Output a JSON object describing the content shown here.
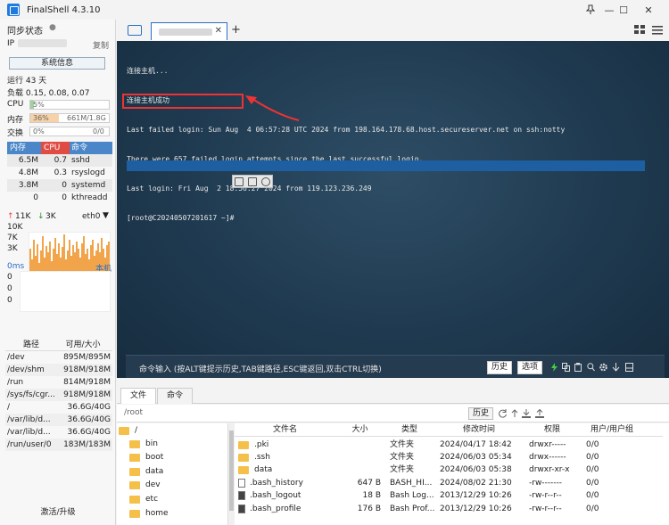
{
  "titlebar": {
    "app_title": "FinalShell 4.3.10",
    "minimize": "—",
    "maximize": "☐",
    "close": "✕"
  },
  "left": {
    "sync_label": "同步状态",
    "ip_label": "IP",
    "copy_label": "复制",
    "sysinfo_button": "系统信息",
    "uptime": "运行 43 天",
    "load": "负载 0.15, 0.08, 0.07",
    "cpu": {
      "label": "CPU",
      "value": "5%",
      "fraction": 0.05
    },
    "mem": {
      "label": "内存",
      "percent": "36%",
      "detail": "661M/1.8G",
      "fraction": 0.36
    },
    "swap": {
      "label": "交换",
      "percent": "0%",
      "detail": "0/0",
      "fraction": 0.0
    },
    "proc_headers": [
      "内存",
      "CPU",
      "命令"
    ],
    "processes": [
      {
        "mem": "6.5M",
        "cpu": "0.7",
        "cmd": "sshd"
      },
      {
        "mem": "4.8M",
        "cpu": "0.3",
        "cmd": "rsyslogd"
      },
      {
        "mem": "3.8M",
        "cpu": "0",
        "cmd": "systemd"
      },
      {
        "mem": "0",
        "cpu": "0",
        "cmd": "kthreadd"
      }
    ],
    "net": {
      "up": "11K",
      "down": "3K",
      "iface": "eth0",
      "ticks": [
        "10K",
        "7K",
        "3K"
      ]
    },
    "ping": {
      "label": "0ms",
      "host": "本机",
      "ticks": [
        "0",
        "0",
        "0"
      ]
    },
    "disk_headers": [
      "路径",
      "可用/大小"
    ],
    "disks": [
      {
        "path": "/dev",
        "size": "895M/895M"
      },
      {
        "path": "/dev/shm",
        "size": "918M/918M"
      },
      {
        "path": "/run",
        "size": "814M/918M"
      },
      {
        "path": "/sys/fs/cgr...",
        "size": "918M/918M"
      },
      {
        "path": "/",
        "size": "36.6G/40G"
      },
      {
        "path": "/var/lib/d...",
        "size": "36.6G/40G"
      },
      {
        "path": "/var/lib/d...",
        "size": "36.6G/40G"
      },
      {
        "path": "/run/user/0",
        "size": "183M/183M"
      }
    ],
    "activate": "激活/升级"
  },
  "tabs": {
    "add": "+",
    "close": "✕"
  },
  "terminal": {
    "lines": [
      "连接主机...",
      "连接主机成功",
      "Last failed login: Sun Aug  4 06:57:28 UTC 2024 from 198.164.178.68.host.secureserver.net on ssh:notty",
      "There were 657 failed login attempts since the last successful login.",
      "Last login: Fri Aug  2 18:56:27 2024 from 119.123.236.249",
      "[root@C20240507201617 ~]#"
    ]
  },
  "cmdbar": {
    "hint": "命令输入 (按ALT键提示历史,TAB键路径,ESC键返回,双击CTRL切换)",
    "history": "历史",
    "options": "选项"
  },
  "files": {
    "tab_files": "文件",
    "tab_commands": "命令",
    "path": "/root",
    "history": "历史",
    "tree": [
      "/",
      "bin",
      "boot",
      "data",
      "dev",
      "etc",
      "home"
    ],
    "headers": [
      "文件名",
      "大小",
      "类型",
      "修改时间",
      "权限",
      "用户/用户组"
    ],
    "rows": [
      {
        "name": ".pki",
        "size": "",
        "type": "文件夹",
        "time": "2024/04/17 18:42",
        "perm": "drwxr-----",
        "owner": "0/0"
      },
      {
        "name": ".ssh",
        "size": "",
        "type": "文件夹",
        "time": "2024/06/03 05:34",
        "perm": "drwx------",
        "owner": "0/0"
      },
      {
        "name": "data",
        "size": "",
        "type": "文件夹",
        "time": "2024/06/03 05:38",
        "perm": "drwxr-xr-x",
        "owner": "0/0"
      },
      {
        "name": ".bash_history",
        "size": "647 B",
        "type": "BASH_HI...",
        "time": "2024/08/02 21:30",
        "perm": "-rw-------",
        "owner": "0/0"
      },
      {
        "name": ".bash_logout",
        "size": "18 B",
        "type": "Bash Log...",
        "time": "2013/12/29 10:26",
        "perm": "-rw-r--r--",
        "owner": "0/0"
      },
      {
        "name": ".bash_profile",
        "size": "176 B",
        "type": "Bash Prof...",
        "time": "2013/12/29 10:26",
        "perm": "-rw-r--r--",
        "owner": "0/0"
      }
    ]
  }
}
